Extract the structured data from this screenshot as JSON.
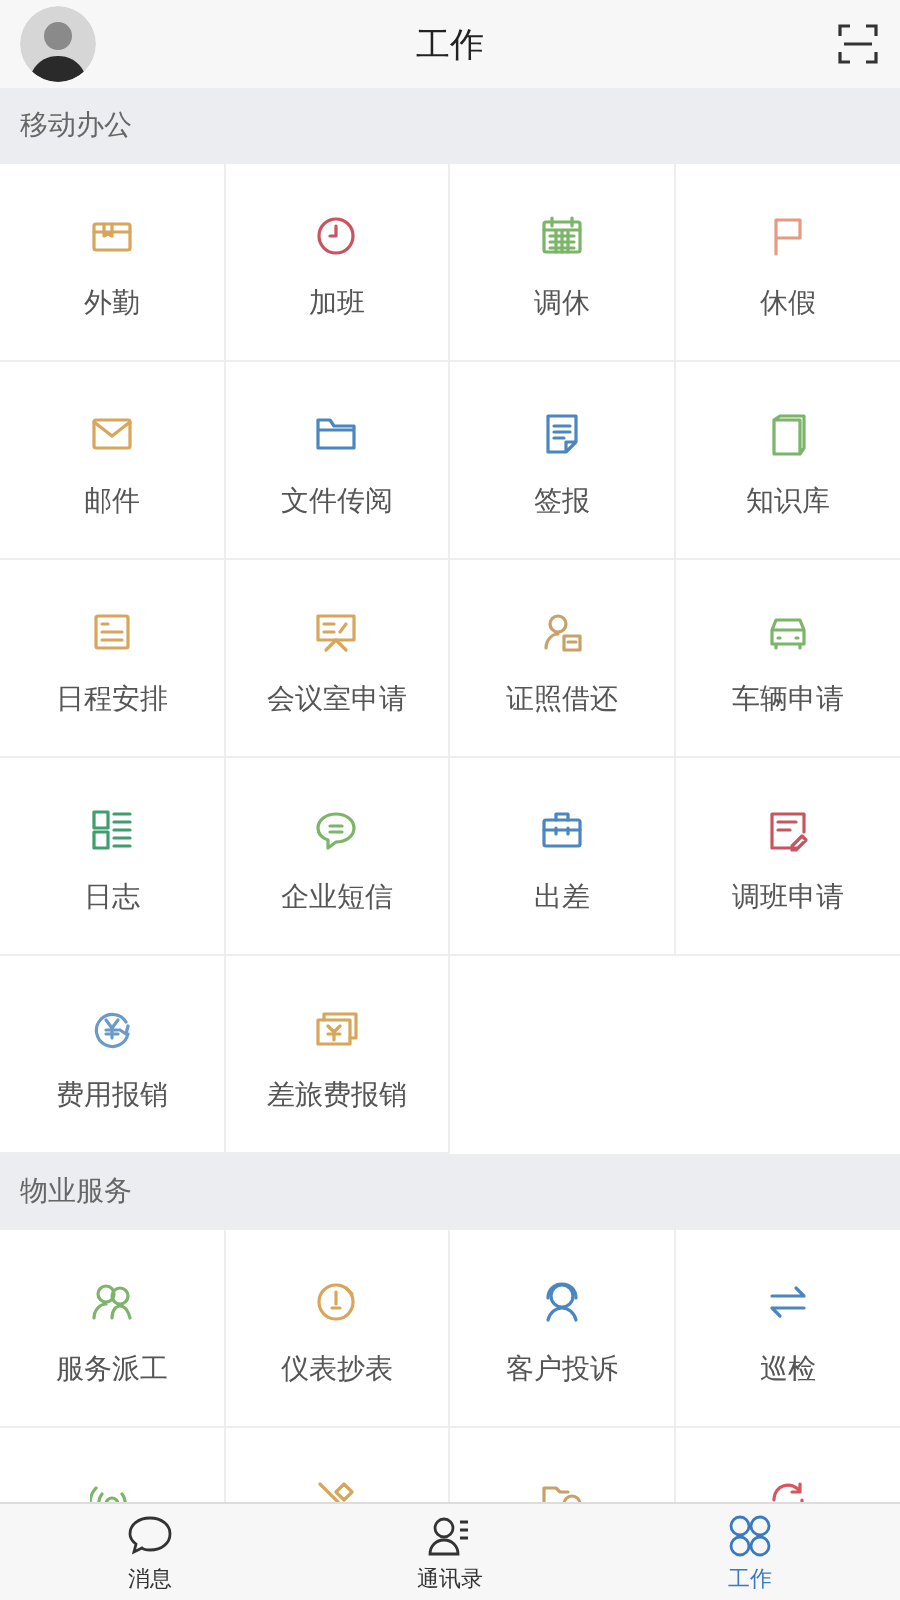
{
  "header": {
    "title": "工作"
  },
  "sections": [
    {
      "title": "移动办公",
      "items": [
        {
          "label": "外勤",
          "color": "#d9a55a"
        },
        {
          "label": "加班",
          "color": "#c9545e"
        },
        {
          "label": "调休",
          "color": "#7bb567"
        },
        {
          "label": "休假",
          "color": "#e59a84"
        },
        {
          "label": "邮件",
          "color": "#d9a55a"
        },
        {
          "label": "文件传阅",
          "color": "#4a86c0"
        },
        {
          "label": "签报",
          "color": "#4a86c0"
        },
        {
          "label": "知识库",
          "color": "#7bb567"
        },
        {
          "label": "日程安排",
          "color": "#d9a55a"
        },
        {
          "label": "会议室申请",
          "color": "#d9a55a"
        },
        {
          "label": "证照借还",
          "color": "#c9a068"
        },
        {
          "label": "车辆申请",
          "color": "#7bb567"
        },
        {
          "label": "日志",
          "color": "#3e9e6e"
        },
        {
          "label": "企业短信",
          "color": "#7bb567"
        },
        {
          "label": "出差",
          "color": "#4a86c0"
        },
        {
          "label": "调班申请",
          "color": "#c9545e"
        },
        {
          "label": "费用报销",
          "color": "#6a9ac8"
        },
        {
          "label": "差旅费报销",
          "color": "#d9a55a"
        }
      ]
    },
    {
      "title": "物业服务",
      "items": [
        {
          "label": "服务派工",
          "color": "#7bb567"
        },
        {
          "label": "仪表抄表",
          "color": "#d9a55a"
        },
        {
          "label": "客户投诉",
          "color": "#4a86c0"
        },
        {
          "label": "巡检",
          "color": "#4a86c0"
        },
        {
          "color": "#7bb567"
        },
        {
          "color": "#d9a55a"
        },
        {
          "color": "#c9a068"
        },
        {
          "color": "#d9545e"
        }
      ]
    }
  ],
  "tabs": [
    {
      "label": "消息",
      "selected": false
    },
    {
      "label": "通讯录",
      "selected": false
    },
    {
      "label": "工作",
      "selected": true
    }
  ]
}
